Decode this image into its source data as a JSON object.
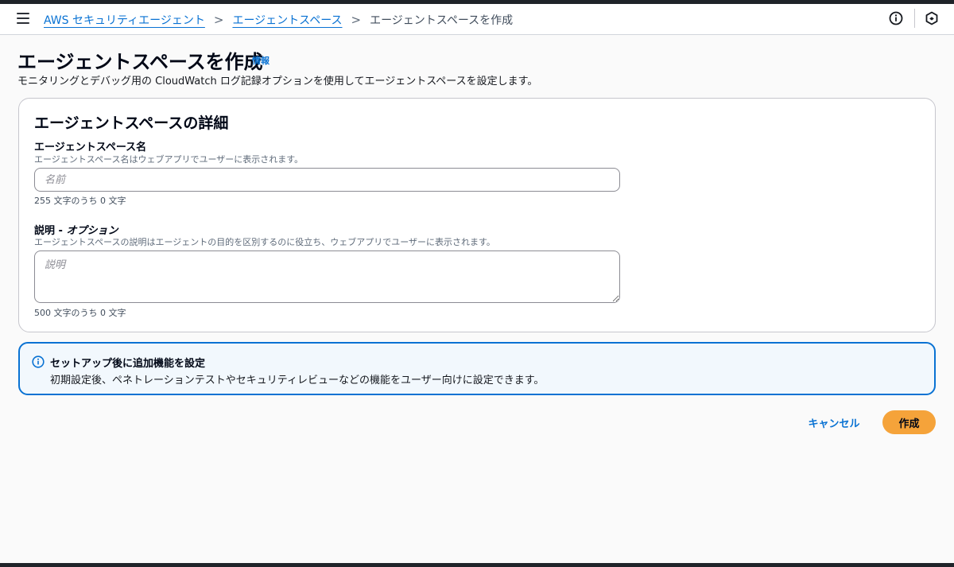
{
  "header": {
    "breadcrumb": [
      {
        "label": "AWS セキュリティエージェント"
      },
      {
        "label": "エージェントスペース"
      },
      {
        "label": "エージェントスペースを作成"
      }
    ],
    "icons": [
      "menu-icon",
      "info-circle-icon",
      "hexagon-icon"
    ]
  },
  "page": {
    "title": "エージェントスペースを作成",
    "info_link": "情報",
    "description": "モニタリングとデバッグ用の CloudWatch ログ記録オプションを使用してエージェントスペースを設定します。"
  },
  "details": {
    "title": "エージェントスペースの詳細",
    "name_field": {
      "label": "エージェントスペース名",
      "hint": "エージェントスペース名はウェブアプリでユーザーに表示されます。",
      "placeholder": "名前",
      "value": "",
      "char_count": "255 文字のうち 0 文字"
    },
    "description_field": {
      "label": "説明 - ",
      "label_optional": "オプション",
      "hint": "エージェントスペースの説明はエージェントの目的を区別するのに役立ち、ウェブアプリでユーザーに表示されます。",
      "placeholder": "説明",
      "value": "",
      "char_count": "500 文字のうち 0 文字"
    }
  },
  "alert": {
    "title": "セットアップ後に追加機能を設定",
    "body": "初期設定後、ペネトレーションテストやセキュリティレビューなどの機能をユーザー向けに設定できます。"
  },
  "actions": {
    "cancel_label": "キャンセル",
    "create_label": "作成"
  },
  "colors": {
    "accent": "#0972d3",
    "primary_button": "#f5a33a",
    "alert_bg": "#f2f8fd"
  }
}
